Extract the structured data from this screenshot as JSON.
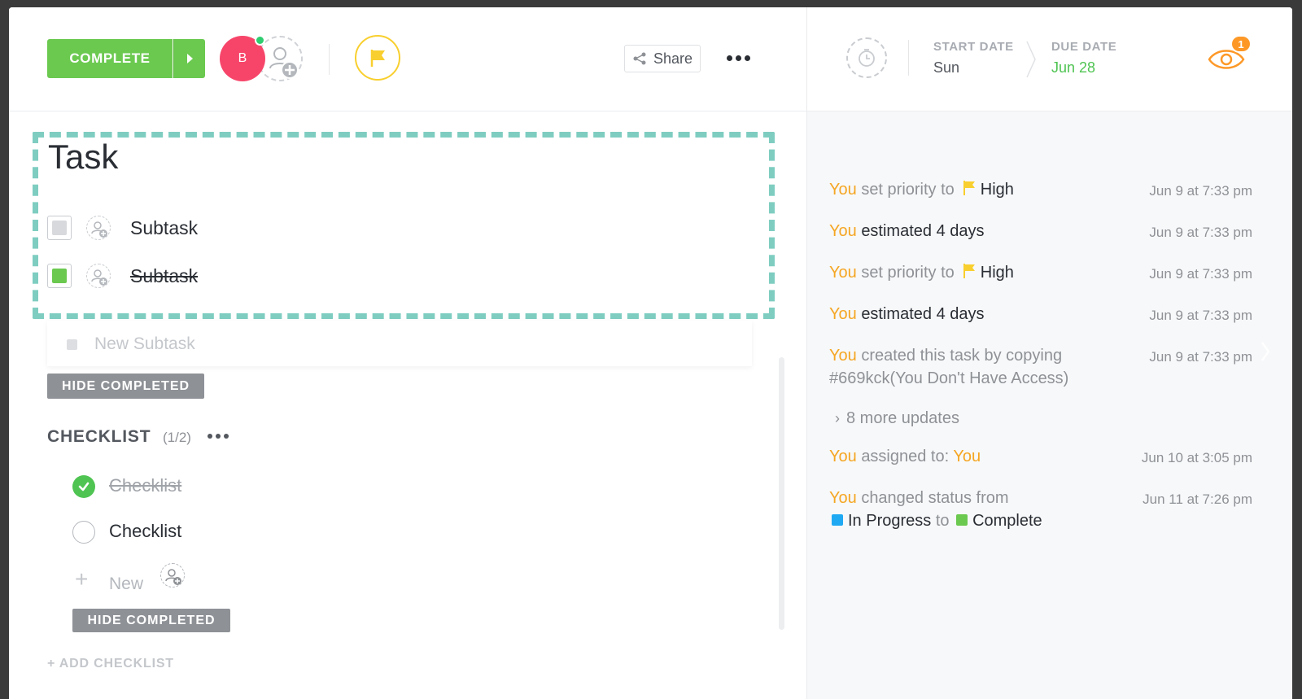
{
  "header": {
    "complete_label": "COMPLETE",
    "assignee_initial": "B",
    "share_label": "Share",
    "start_date_label": "START DATE",
    "start_date_value": "Sun",
    "due_date_label": "DUE DATE",
    "due_date_value": "Jun 28",
    "watchers_count": "1"
  },
  "task": {
    "title": "Task",
    "subtasks": [
      {
        "label": "Subtask",
        "done": false
      },
      {
        "label": "Subtask",
        "done": true
      }
    ],
    "new_subtask_placeholder": "New Subtask",
    "hide_completed_label": "HIDE COMPLETED"
  },
  "checklist": {
    "title": "CHECKLIST",
    "count": "(1/2)",
    "items": [
      {
        "label": "Checklist",
        "done": true
      },
      {
        "label": "Checklist",
        "done": false
      }
    ],
    "new_label": "New",
    "hide_completed_label": "HIDE COMPLETED",
    "add_checklist_label": "+ ADD CHECKLIST"
  },
  "activity": {
    "items": [
      {
        "actor": "You",
        "text": "set priority to",
        "value": "High",
        "time": "Jun 9 at 7:33 pm"
      },
      {
        "actor": "You",
        "text": "estimated 4 days",
        "time": "Jun 9 at 7:33 pm"
      },
      {
        "actor": "You",
        "text": "set priority to",
        "value": "High",
        "time": "Jun 9 at 7:33 pm"
      },
      {
        "actor": "You",
        "text": "estimated 4 days",
        "time": "Jun 9 at 7:33 pm"
      },
      {
        "actor": "You",
        "text": "created this task by copying",
        "text2": "#669kck(You Don't Have Access)",
        "time": "Jun 9 at 7:33 pm"
      },
      {
        "actor": "You",
        "text": "assigned to:",
        "value": "You",
        "time": "Jun 10 at 3:05 pm"
      },
      {
        "actor": "You",
        "text": "changed status from",
        "from": "In Progress",
        "to_word": "to",
        "to": "Complete",
        "time": "Jun 11 at 7:26 pm"
      }
    ],
    "more_updates": "8 more updates"
  },
  "colors": {
    "complete_green": "#6bc950",
    "avatar_pink": "#f7456a",
    "priority_yellow": "#f8cf2e",
    "actor_orange": "#f5a623",
    "due_green": "#4fc452",
    "in_progress_blue": "#20a9f3",
    "dash_teal": "#7fcdc1"
  }
}
